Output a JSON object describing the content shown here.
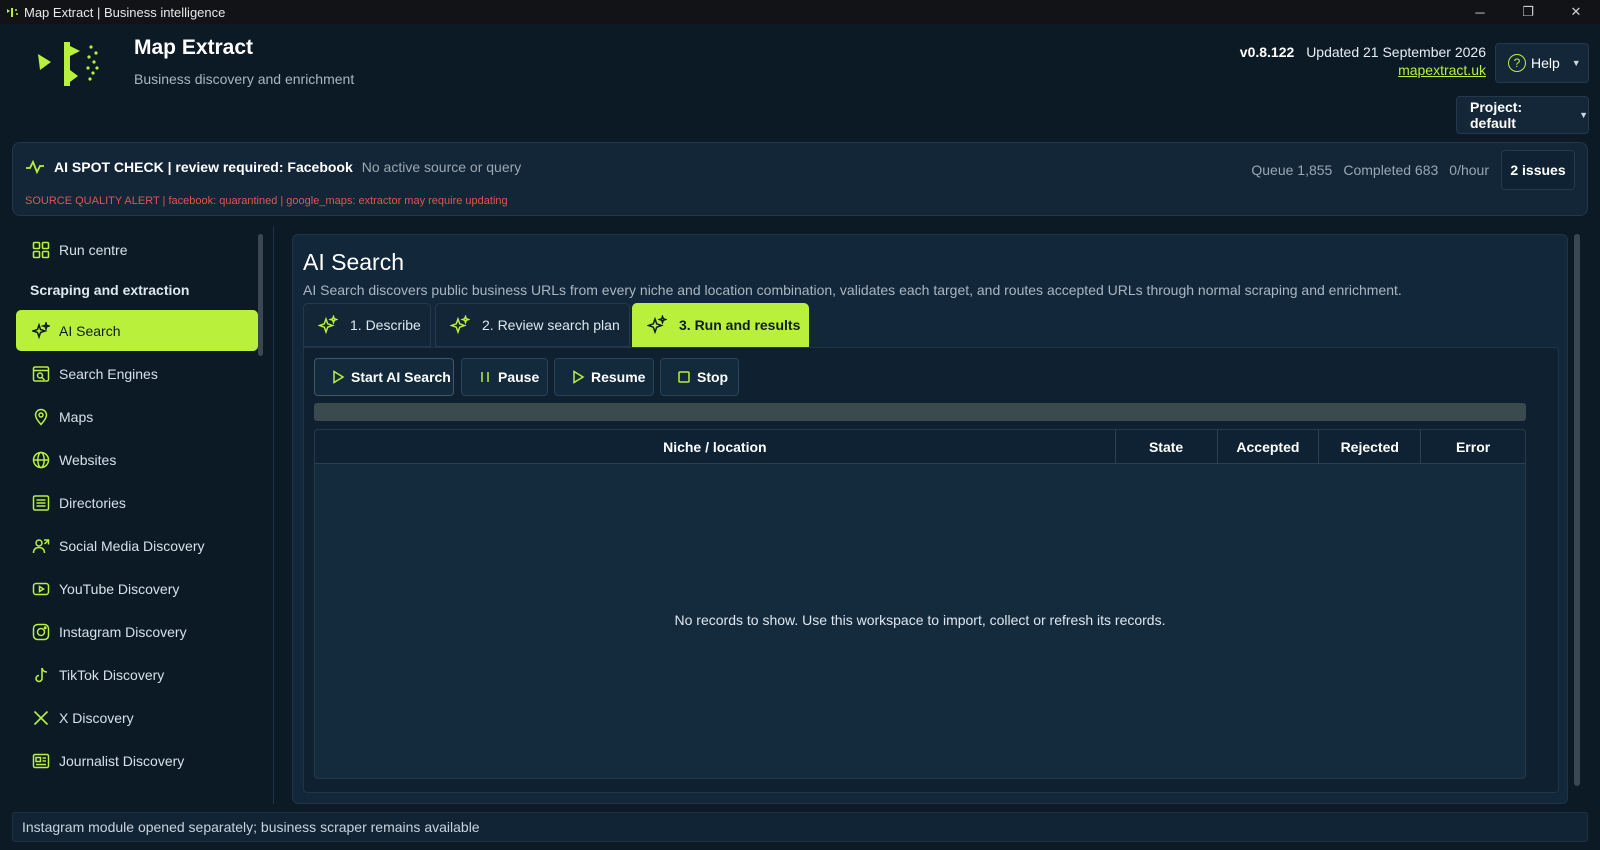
{
  "window": {
    "title": "Map Extract | Business intelligence",
    "controls": {
      "minimize": "─",
      "restore": "❐",
      "close": "✕"
    }
  },
  "header": {
    "app_name": "Map Extract",
    "subtitle": "Business discovery and enrichment",
    "version": "v0.8.122",
    "updated": "Updated 21 September 2026",
    "link": "mapextract.uk",
    "help_label": "Help",
    "project_label": "Project: default"
  },
  "status": {
    "spot_check": "AI SPOT CHECK | review required: Facebook",
    "no_source": "No active source or query",
    "alert": "SOURCE QUALITY ALERT | facebook: quarantined | google_maps: extractor may require updating",
    "queue": "Queue 1,855",
    "completed": "Completed 683",
    "rate": "0/hour",
    "issues_label": "2 issues"
  },
  "sidebar": {
    "run_centre": "Run centre",
    "heading": "Scraping and extraction",
    "items": [
      {
        "label": "AI Search",
        "icon": "sparkles-icon",
        "active": true
      },
      {
        "label": "Search Engines",
        "icon": "search-window-icon"
      },
      {
        "label": "Maps",
        "icon": "map-pin-icon"
      },
      {
        "label": "Websites",
        "icon": "globe-icon"
      },
      {
        "label": "Directories",
        "icon": "list-icon"
      },
      {
        "label": "Social Media Discovery",
        "icon": "users-icon"
      },
      {
        "label": "YouTube Discovery",
        "icon": "youtube-icon"
      },
      {
        "label": "Instagram Discovery",
        "icon": "instagram-icon"
      },
      {
        "label": "TikTok Discovery",
        "icon": "tiktok-icon"
      },
      {
        "label": "X Discovery",
        "icon": "x-icon"
      },
      {
        "label": "Journalist Discovery",
        "icon": "newspaper-icon"
      }
    ]
  },
  "main": {
    "title": "AI Search",
    "description": "AI Search discovers public business URLs from every niche and location combination, validates each target, and routes accepted URLs through normal scraping and enrichment.",
    "tabs": [
      {
        "label": "1. Describe"
      },
      {
        "label": "2. Review search plan"
      },
      {
        "label": "3. Run and results",
        "active": true
      }
    ],
    "buttons": {
      "start": "Start AI Search",
      "pause": "Pause",
      "resume": "Resume",
      "stop": "Stop"
    },
    "progress": 0,
    "table": {
      "columns": [
        "Niche / location",
        "State",
        "Accepted",
        "Rejected",
        "Error"
      ],
      "empty": "No records to show. Use this workspace to import, collect or refresh its records."
    }
  },
  "statusbar": {
    "text": "Instagram module opened separately; business scraper remains available"
  },
  "colors": {
    "accent": "#b8f03c",
    "background": "#0c1a26",
    "panel": "#122638",
    "alert": "#e0564f"
  }
}
